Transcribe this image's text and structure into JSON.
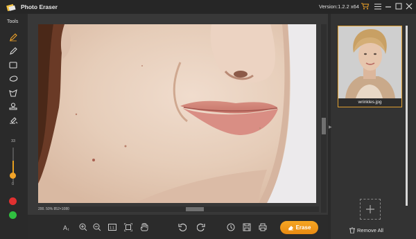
{
  "app": {
    "title": "Photo Eraser",
    "version": "Version:1.2.2 x64"
  },
  "tools": {
    "label": "Tools",
    "items": [
      "pencil-icon",
      "brush-icon",
      "rectangle-select-icon",
      "lasso-icon",
      "polygon-lasso-icon",
      "stamp-icon",
      "smart-brush-icon"
    ],
    "brush_size_max": "33",
    "brush_size_min": "0",
    "brush_size_level": 0.4,
    "colors": [
      "#e03030",
      "#30c040"
    ]
  },
  "canvas": {
    "zoom_info": "200. 50%  852×1080"
  },
  "toolbar": {
    "icons": [
      "text-size-icon",
      "zoom-in-icon",
      "zoom-out-icon",
      "actual-size-icon",
      "fit-screen-icon",
      "hand-icon",
      "undo-icon",
      "redo-icon",
      "history-icon",
      "save-icon",
      "print-icon"
    ],
    "erase_label": "Erase"
  },
  "files": {
    "items": [
      {
        "name": "wrinkles.jpg"
      }
    ],
    "remove_all_label": "Remove All"
  },
  "colors": {
    "accent": "#f2a428",
    "background": "#2e2e2e",
    "titlebar": "#262626"
  }
}
